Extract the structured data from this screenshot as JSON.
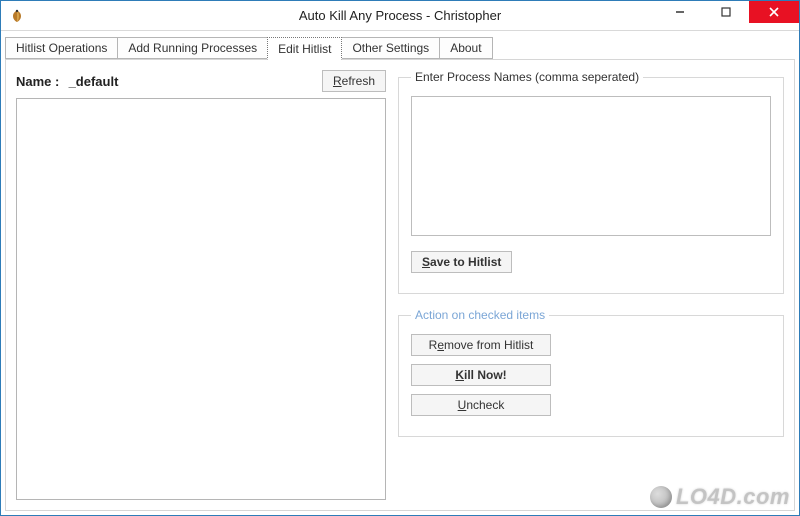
{
  "window": {
    "title": "Auto Kill Any Process - Christopher"
  },
  "tabs": [
    {
      "label": "Hitlist Operations"
    },
    {
      "label": "Add Running Processes"
    },
    {
      "label": "Edit Hitlist"
    },
    {
      "label": "Other Settings"
    },
    {
      "label": "About"
    }
  ],
  "activeTab": 2,
  "left": {
    "nameLabel": "Name :  ",
    "nameValue": "_default",
    "refresh": "Refresh"
  },
  "right": {
    "enterGroupLegend": "Enter Process Names (comma seperated)",
    "processNames": "",
    "saveBtn": "Save to Hitlist",
    "actionGroupLegend": "Action on checked items",
    "removeBtn": "Remove from Hitlist",
    "killBtn": "Kill Now!",
    "uncheckBtn": "Uncheck"
  },
  "watermark": "LO4D.com"
}
